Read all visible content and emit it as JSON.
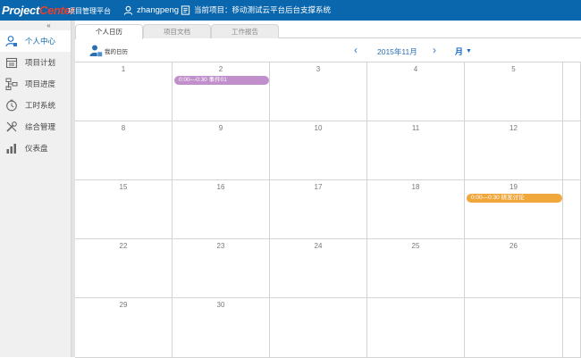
{
  "header": {
    "logo_project": "Project",
    "logo_center": "Center",
    "logo_subtitle": "项目管理平台",
    "username": "zhangpeng",
    "current_project": "当前项目：移动测试云平台后台支撑系统"
  },
  "sidebar": {
    "collapse": "«",
    "items": [
      {
        "label": "个人中心",
        "icon": "user-icon",
        "active": true
      },
      {
        "label": "项目计划",
        "icon": "calendar-icon"
      },
      {
        "label": "项目进度",
        "icon": "hierarchy-icon"
      },
      {
        "label": "工时系统",
        "icon": "clock-icon"
      },
      {
        "label": "综合管理",
        "icon": "tools-icon"
      },
      {
        "label": "仪表盘",
        "icon": "bar-chart-icon"
      }
    ]
  },
  "tabs": [
    {
      "label": "个人日历",
      "active": true
    },
    {
      "label": "项目文档",
      "active": false
    },
    {
      "label": "工作报告",
      "active": false
    }
  ],
  "toolbar": {
    "my_calendar": "我的日历",
    "prev": "‹",
    "month_label": "2015年11月",
    "next": "›",
    "view_label": "月",
    "view_caret": "▼"
  },
  "calendar": {
    "weeks": [
      [
        "1",
        "2",
        "3",
        "4",
        "5",
        ""
      ],
      [
        "8",
        "9",
        "10",
        "11",
        "12",
        ""
      ],
      [
        "15",
        "16",
        "17",
        "18",
        "19",
        ""
      ],
      [
        "22",
        "23",
        "24",
        "25",
        "26",
        ""
      ],
      [
        "29",
        "30",
        "",
        "",
        "",
        ""
      ]
    ],
    "events": [
      {
        "week": 0,
        "day": 1,
        "text": "0:00—0:30 事件01",
        "color": "#c08fcc"
      },
      {
        "week": 2,
        "day": 4,
        "text": "0:00—0:30 研发讨论",
        "color": "#f0a73c"
      }
    ]
  },
  "colors": {
    "header_bg": "#0b67ad",
    "accent": "#2b7ac9"
  }
}
